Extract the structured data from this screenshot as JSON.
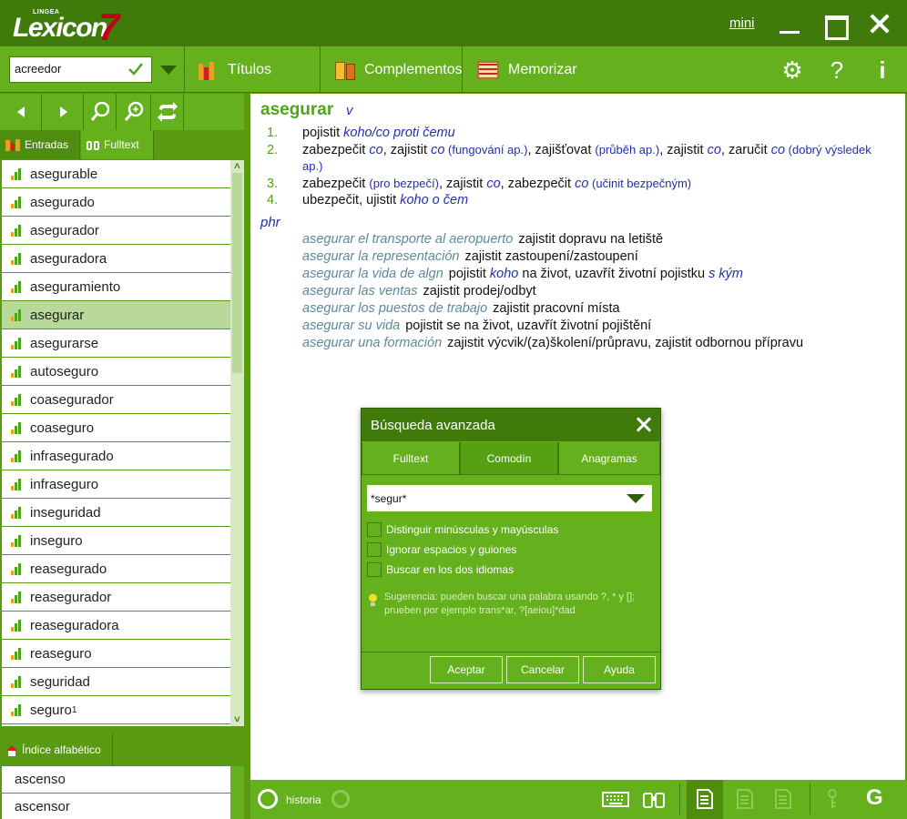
{
  "app": {
    "brand": "Lexicon",
    "brand_number": "7",
    "maker": "LINGEA",
    "mini_label": "mini"
  },
  "toolbar": {
    "search_value": "acreedor",
    "titulos_label": "Títulos",
    "complementos_label": "Complementos",
    "memorizar_label": "Memorizar"
  },
  "left_tabs": {
    "entradas": "Entradas",
    "fulltext": "Fulltext"
  },
  "word_list": [
    {
      "word": "asegurable",
      "sup": ""
    },
    {
      "word": "asegurado",
      "sup": ""
    },
    {
      "word": "asegurador",
      "sup": ""
    },
    {
      "word": "aseguradora",
      "sup": ""
    },
    {
      "word": "aseguramiento",
      "sup": ""
    },
    {
      "word": "asegurar",
      "sup": ""
    },
    {
      "word": "asegurarse",
      "sup": ""
    },
    {
      "word": "autoseguro",
      "sup": ""
    },
    {
      "word": "coasegurador",
      "sup": ""
    },
    {
      "word": "coaseguro",
      "sup": ""
    },
    {
      "word": "infrasegurado",
      "sup": ""
    },
    {
      "word": "infraseguro",
      "sup": ""
    },
    {
      "word": "inseguridad",
      "sup": ""
    },
    {
      "word": "inseguro",
      "sup": ""
    },
    {
      "word": "reasegurado",
      "sup": ""
    },
    {
      "word": "reasegurador",
      "sup": ""
    },
    {
      "word": "reaseguradora",
      "sup": ""
    },
    {
      "word": "reaseguro",
      "sup": ""
    },
    {
      "word": "seguridad",
      "sup": ""
    },
    {
      "word": "seguro",
      "sup": "1"
    }
  ],
  "selected_word_index": 5,
  "alpha": {
    "tab_label": "Índice alfabético",
    "items": [
      "ascenso",
      "ascensor"
    ]
  },
  "entry": {
    "headword": "asegurar",
    "pos": "v",
    "senses": [
      {
        "num": "1.",
        "parts": [
          [
            "t",
            "pojistit "
          ],
          [
            "b",
            "koho/co proti čemu"
          ]
        ]
      },
      {
        "num": "2.",
        "parts": [
          [
            "t",
            "zabezpečit "
          ],
          [
            "b",
            "co"
          ],
          [
            "t",
            ", zajistit "
          ],
          [
            "b",
            "co"
          ],
          [
            "g",
            " (fungování ap.)"
          ],
          [
            "t",
            ", zajišťovat "
          ],
          [
            "g",
            "(průběh ap.)"
          ],
          [
            "t",
            ", zajistit "
          ],
          [
            "b",
            "co"
          ],
          [
            "t",
            ", zaručit "
          ],
          [
            "b",
            "co"
          ],
          [
            "g",
            " (dobrý výsledek ap.)"
          ]
        ]
      },
      {
        "num": "3.",
        "parts": [
          [
            "t",
            "zabezpečit "
          ],
          [
            "g",
            "(pro bezpečí)"
          ],
          [
            "t",
            ", zajistit "
          ],
          [
            "b",
            "co"
          ],
          [
            "t",
            ", zabezpečit "
          ],
          [
            "b",
            "co"
          ],
          [
            "g",
            " (učinit bezpečným)"
          ]
        ]
      },
      {
        "num": "4.",
        "parts": [
          [
            "t",
            "ubezpečit, ujistit "
          ],
          [
            "b",
            "koho o čem"
          ]
        ]
      }
    ],
    "phr_label": "phr",
    "phrases": [
      {
        "es": "asegurar el transporte al aeropuerto",
        "cz": [
          [
            "t",
            "zajistit dopravu na letiště"
          ]
        ]
      },
      {
        "es": "asegurar la representación",
        "cz": [
          [
            "t",
            "zajistit zastoupení/zastoupení"
          ]
        ]
      },
      {
        "es": "asegurar la vida de algn",
        "cz": [
          [
            "t",
            "pojistit "
          ],
          [
            "b",
            "koho"
          ],
          [
            "t",
            " na život, uzavřít životní pojistku "
          ],
          [
            "b",
            "s kým"
          ]
        ]
      },
      {
        "es": "asegurar las ventas",
        "cz": [
          [
            "t",
            "zajistit prodej/odbyt"
          ]
        ]
      },
      {
        "es": "asegurar los puestos de trabajo",
        "cz": [
          [
            "t",
            "zajistit pracovní místa"
          ]
        ]
      },
      {
        "es": "asegurar su vida",
        "cz": [
          [
            "t",
            "pojistit se na život, uzavřít životní pojištění"
          ]
        ]
      },
      {
        "es": "asegurar una formación",
        "cz": [
          [
            "t",
            "zajistit výcvik/(za)školení/průpravu, zajistit odbornou přípravu"
          ]
        ]
      }
    ]
  },
  "status": {
    "history_label": "historia"
  },
  "dialog": {
    "title": "Búsqueda avanzada",
    "tabs": [
      "Fulltext",
      "Comodín",
      "Anagramas"
    ],
    "active_tab": 1,
    "pattern_value": "*segur*",
    "checks": [
      "Distinguir minúsculas y mayúsculas",
      "Ignorar espacios y guiones",
      "Buscar en los dos idiomas"
    ],
    "hint": "Sugerencia: pueden buscar una palabra usando ?, * y []; prueben por ejemplo trans*ar, ?[aeiou]*dad",
    "buttons": [
      "Aceptar",
      "Cancelar",
      "Ayuda"
    ]
  }
}
